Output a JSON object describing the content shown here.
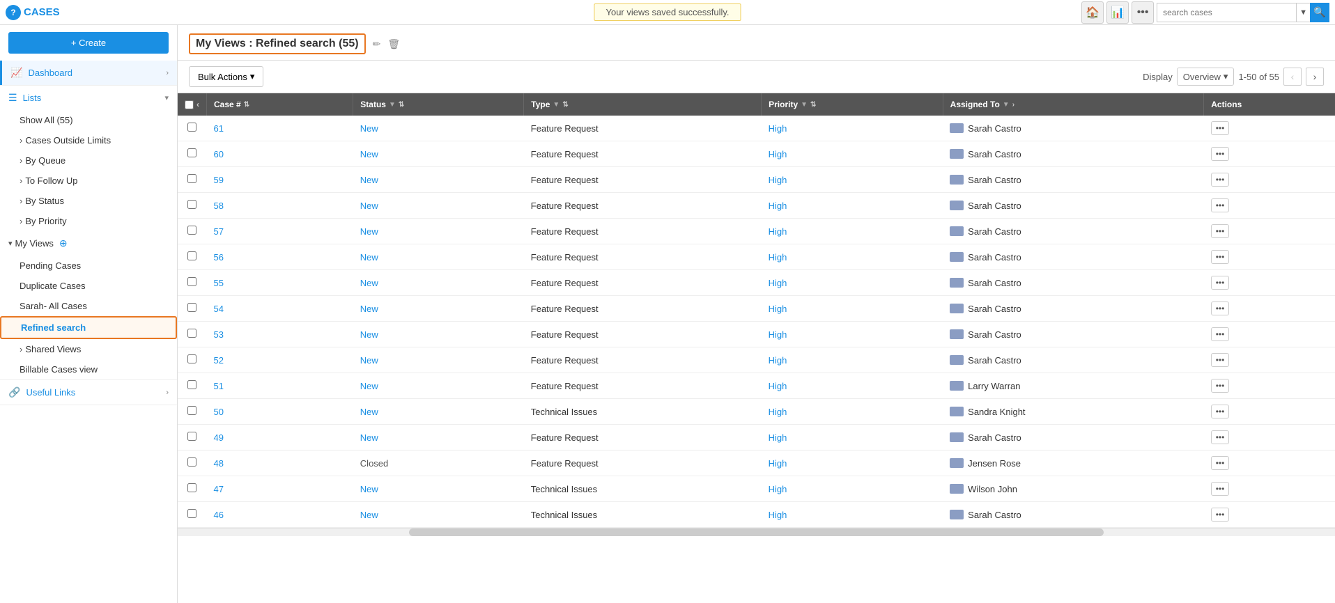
{
  "app": {
    "title": "CASES",
    "logo_char": "?"
  },
  "topnav": {
    "success_message": "Your views saved successfully.",
    "search_placeholder": "search cases",
    "home_icon": "🏠",
    "chart_icon": "📊",
    "more_icon": "•••",
    "search_icon": "🔍",
    "dropdown_icon": "▼"
  },
  "sidebar": {
    "create_label": "+ Create",
    "dashboard_label": "Dashboard",
    "lists_label": "Lists",
    "show_all_label": "Show All (55)",
    "cases_outside_limits_label": "Cases Outside Limits",
    "by_queue_label": "By Queue",
    "to_follow_up_label": "To Follow Up",
    "by_status_label": "By Status",
    "by_priority_label": "By Priority",
    "my_views_label": "My Views",
    "pending_cases_label": "Pending Cases",
    "duplicate_cases_label": "Duplicate Cases",
    "sarah_all_cases_label": "Sarah- All Cases",
    "refined_search_label": "Refined search",
    "shared_views_label": "Shared Views",
    "billable_cases_label": "Billable Cases view",
    "useful_links_label": "Useful Links"
  },
  "main": {
    "view_title": "My Views : Refined search (55)",
    "bulk_actions_label": "Bulk Actions",
    "display_label": "Display",
    "display_mode": "Overview",
    "page_info": "1-50 of 55"
  },
  "table": {
    "columns": [
      "",
      "Case #",
      "Status",
      "Type",
      "Priority",
      "Assigned To",
      "Actions"
    ],
    "rows": [
      {
        "case_num": "61",
        "status": "New",
        "type": "Feature Request",
        "priority": "High",
        "assigned": "Sarah Castro",
        "status_class": "status-new"
      },
      {
        "case_num": "60",
        "status": "New",
        "type": "Feature Request",
        "priority": "High",
        "assigned": "Sarah Castro",
        "status_class": "status-new"
      },
      {
        "case_num": "59",
        "status": "New",
        "type": "Feature Request",
        "priority": "High",
        "assigned": "Sarah Castro",
        "status_class": "status-new"
      },
      {
        "case_num": "58",
        "status": "New",
        "type": "Feature Request",
        "priority": "High",
        "assigned": "Sarah Castro",
        "status_class": "status-new"
      },
      {
        "case_num": "57",
        "status": "New",
        "type": "Feature Request",
        "priority": "High",
        "assigned": "Sarah Castro",
        "status_class": "status-new"
      },
      {
        "case_num": "56",
        "status": "New",
        "type": "Feature Request",
        "priority": "High",
        "assigned": "Sarah Castro",
        "status_class": "status-new"
      },
      {
        "case_num": "55",
        "status": "New",
        "type": "Feature Request",
        "priority": "High",
        "assigned": "Sarah Castro",
        "status_class": "status-new"
      },
      {
        "case_num": "54",
        "status": "New",
        "type": "Feature Request",
        "priority": "High",
        "assigned": "Sarah Castro",
        "status_class": "status-new"
      },
      {
        "case_num": "53",
        "status": "New",
        "type": "Feature Request",
        "priority": "High",
        "assigned": "Sarah Castro",
        "status_class": "status-new"
      },
      {
        "case_num": "52",
        "status": "New",
        "type": "Feature Request",
        "priority": "High",
        "assigned": "Sarah Castro",
        "status_class": "status-new"
      },
      {
        "case_num": "51",
        "status": "New",
        "type": "Feature Request",
        "priority": "High",
        "assigned": "Larry Warran",
        "status_class": "status-new"
      },
      {
        "case_num": "50",
        "status": "New",
        "type": "Technical Issues",
        "priority": "High",
        "assigned": "Sandra Knight",
        "status_class": "status-new"
      },
      {
        "case_num": "49",
        "status": "New",
        "type": "Feature Request",
        "priority": "High",
        "assigned": "Sarah Castro",
        "status_class": "status-new"
      },
      {
        "case_num": "48",
        "status": "Closed",
        "type": "Feature Request",
        "priority": "High",
        "assigned": "Jensen Rose",
        "status_class": "status-closed"
      },
      {
        "case_num": "47",
        "status": "New",
        "type": "Technical Issues",
        "priority": "High",
        "assigned": "Wilson John",
        "status_class": "status-new"
      },
      {
        "case_num": "46",
        "status": "New",
        "type": "Technical Issues",
        "priority": "High",
        "assigned": "Sarah Castro",
        "status_class": "status-new"
      }
    ]
  },
  "icons": {
    "pencil": "✏",
    "trash": "🗑",
    "chevron_right": "›",
    "chevron_left": "‹",
    "chevron_down": "▾",
    "chevron_down_small": "▾",
    "expand": "›",
    "collapse": "‹",
    "sort_up_down": "⇅",
    "filter": "▼",
    "ellipsis": "•••",
    "plus": "+"
  },
  "colors": {
    "accent_blue": "#1a8fe3",
    "orange_border": "#e87722",
    "header_dark": "#555555",
    "success_bg": "#fffde7"
  }
}
